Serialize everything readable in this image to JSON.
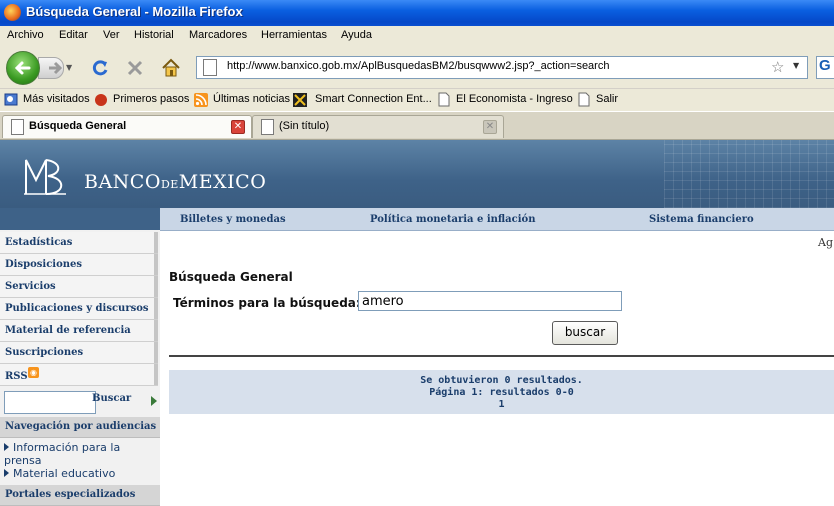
{
  "window": {
    "title": "Búsqueda General - Mozilla Firefox"
  },
  "menu": [
    "Archivo",
    "Editar",
    "Ver",
    "Historial",
    "Marcadores",
    "Herramientas",
    "Ayuda"
  ],
  "navigation": {
    "url": "http://www.banxico.gob.mx/AplBusquedasBM2/busqwww2.jsp?_action=search"
  },
  "bookmarks": [
    "Más visitados",
    "Primeros pasos",
    "Últimas noticias",
    "Smart Connection Ent...",
    "El Economista - Ingreso",
    "Salir"
  ],
  "tabs": [
    {
      "label": "Búsqueda General",
      "active": true
    },
    {
      "label": "(Sin título)",
      "active": false
    }
  ],
  "header": {
    "bank_name_pre": "BANCO",
    "bank_name_de": "DE",
    "bank_name_post": "MEXICO"
  },
  "topnav": [
    "Billetes y monedas",
    "Política monetaria e inflación",
    "Sistema financiero"
  ],
  "sidebar": {
    "items": [
      "Estadísticas",
      "Disposiciones",
      "Servicios",
      "Publicaciones y discursos",
      "Material de referencia",
      "Suscripciones",
      "RSS"
    ],
    "search_button": "Buscar",
    "audiences_heading": "Navegación por audiencias",
    "audience_links": [
      "Información para la prensa",
      "Material educativo"
    ],
    "portals_heading": "Portales especializados"
  },
  "main": {
    "corner_stub": "Ag",
    "heading": "Búsqueda General",
    "terms_label": "Términos para la búsqueda:",
    "terms_value": "amero",
    "search_button": "buscar",
    "results": {
      "line1": "Se obtuvieron 0 resultados.",
      "line2": "Página 1:  resultados 0-0",
      "line3": "1"
    }
  },
  "colors": {
    "title_bar": "#0a5fe0",
    "banner": "#3e6288",
    "nav_text": "#1a3d6b",
    "results_bg": "#d7e0ec"
  }
}
